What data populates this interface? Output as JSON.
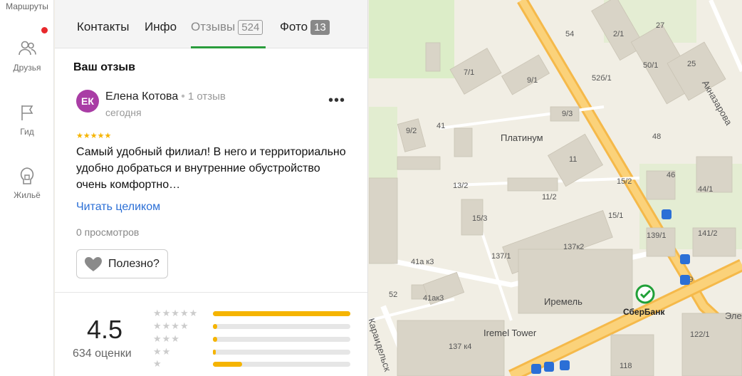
{
  "rail": {
    "top_label": "Маршруты",
    "items": [
      {
        "label": "Друзья",
        "icon": "friends-icon"
      },
      {
        "label": "Гид",
        "icon": "flag-icon"
      },
      {
        "label": "Жильё",
        "icon": "housing-icon"
      }
    ]
  },
  "tabs": [
    {
      "label": "Контакты"
    },
    {
      "label": "Инфо"
    },
    {
      "label": "Отзывы",
      "count": "524"
    },
    {
      "label": "Фото",
      "count": "13"
    }
  ],
  "review_section": {
    "title": "Ваш отзыв",
    "author_initials": "ЕК",
    "author_name": "Елена Котова",
    "author_reviews": "1 отзыв",
    "date": "сегодня",
    "stars": "★★★★★",
    "rating": 5,
    "text": "Самый удобный филиал! В него и территориально удобно добраться и внутренние обустройство очень комфортно…",
    "read_more": "Читать целиком",
    "views": "0 просмотров",
    "useful_label": "Полезно?",
    "more_label": "•••"
  },
  "summary": {
    "rating": "4.5",
    "ratings_count": "634 оценки",
    "distribution": [
      {
        "stars": "★★★★★",
        "fraction": 1.0
      },
      {
        "stars": "★★★★",
        "fraction": 0.03
      },
      {
        "stars": "★★★",
        "fraction": 0.03
      },
      {
        "stars": "★★",
        "fraction": 0.02
      },
      {
        "stars": "★",
        "fraction": 0.21
      }
    ]
  },
  "colors": {
    "accent_green": "#2a9c3c",
    "star_yellow": "#f5b400",
    "link_blue": "#2b6fd6",
    "avatar_purple": "#a93da5",
    "road_orange": "#f5b94a"
  },
  "map": {
    "labels": [
      "54",
      "2/1",
      "27",
      "50/1",
      "25",
      "Акназарова",
      "52б/1",
      "9/1",
      "7/1",
      "9/3",
      "9/2",
      "41",
      "48",
      "46",
      "44/1",
      "11",
      "15/2",
      "13/2",
      "11/2",
      "15/3",
      "15/1",
      "139/1",
      "141/2",
      "137/1",
      "137к2",
      "139",
      "41а к3",
      "52",
      "41ак3",
      "137 к4",
      "118",
      "122/1",
      "Караидельск",
      "Элем"
    ],
    "pois": [
      "Платинум",
      "Иремель",
      "Iremel Tower",
      "СберБанк"
    ]
  }
}
